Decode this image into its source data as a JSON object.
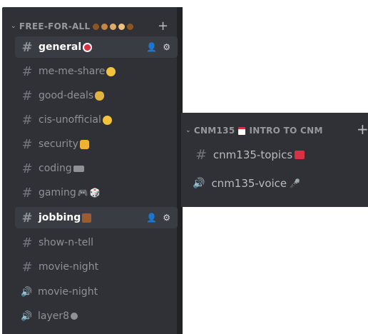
{
  "category_left": {
    "label": "FREE-FOR-ALL",
    "dots": [
      "#8d5524",
      "#c68642",
      "#e0ac69",
      "#f1c27d",
      "#8d5524"
    ]
  },
  "channels": [
    {
      "name": "general",
      "type": "text",
      "selected": true,
      "icon": "dart-emoji",
      "emoji_color": "#dd2e44"
    },
    {
      "name": "me-me-share",
      "type": "text",
      "icon": "laughing-emoji",
      "emoji_color": "#f5c33b"
    },
    {
      "name": "good-deals",
      "type": "text",
      "icon": "money-bag-emoji",
      "emoji_color": "#e3b341"
    },
    {
      "name": "cis-unofficial",
      "type": "text",
      "icon": "crying-face-emoji",
      "emoji_color": "#f5c33b"
    },
    {
      "name": "security",
      "type": "text",
      "icon": "lock-emoji",
      "emoji_color": "#f0b232"
    },
    {
      "name": "coding",
      "type": "text",
      "icon": "keyboard-emoji",
      "emoji_color": "#8e9297"
    },
    {
      "name": "gaming",
      "type": "text",
      "icon": "gamepad-die-emoji",
      "emoji_color": "#b9bbbe"
    },
    {
      "name": "jobbing",
      "type": "text",
      "selected": true,
      "icon": "briefcase-emoji",
      "emoji_color": "#9c5d2e"
    },
    {
      "name": "show-n-tell",
      "type": "text"
    },
    {
      "name": "movie-night",
      "type": "text"
    },
    {
      "name": "movie-night",
      "type": "voice"
    },
    {
      "name": "layer8",
      "type": "voice",
      "icon": "brain-emoji",
      "emoji_color": "#8e9297"
    }
  ],
  "category_right": {
    "label": "CNM135",
    "label_rest": "INTRO TO CNM"
  },
  "right_channels": [
    {
      "name": "cnm135-topics",
      "type": "text",
      "icon": "school-emoji",
      "emoji_color": "#dd2e44"
    },
    {
      "name": "cnm135-voice",
      "type": "voice",
      "icon": "microphone-emoji",
      "emoji_color": "#dcddde"
    }
  ],
  "symbols": {
    "hash": "#",
    "speaker": "🔊",
    "plus": "+",
    "chevron": "⌄"
  }
}
